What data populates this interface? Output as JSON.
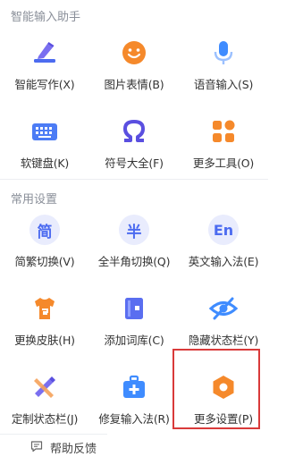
{
  "sections": {
    "assistant": {
      "title": "智能输入助手",
      "items": [
        {
          "label": "智能写作(X)",
          "icon": "pen-icon"
        },
        {
          "label": "图片表情(B)",
          "icon": "emoji-icon"
        },
        {
          "label": "语音输入(S)",
          "icon": "microphone-icon"
        },
        {
          "label": "软键盘(K)",
          "icon": "keyboard-icon"
        },
        {
          "label": "符号大全(F)",
          "icon": "omega-icon"
        },
        {
          "label": "更多工具(O)",
          "icon": "tools-grid-icon"
        }
      ]
    },
    "settings": {
      "title": "常用设置",
      "items": [
        {
          "label": "简繁切换(V)",
          "icon": "simplified-traditional-icon",
          "glyph": "简"
        },
        {
          "label": "全半角切换(Q)",
          "icon": "fullwidth-halfwidth-icon",
          "glyph": "半"
        },
        {
          "label": "英文输入法(E)",
          "icon": "english-input-icon",
          "glyph": "En"
        },
        {
          "label": "更换皮肤(H)",
          "icon": "skin-shirt-icon"
        },
        {
          "label": "添加词库(C)",
          "icon": "dictionary-book-icon"
        },
        {
          "label": "隐藏状态栏(Y)",
          "icon": "hide-eye-icon"
        },
        {
          "label": "定制状态栏(J)",
          "icon": "custom-pencil-ruler-icon"
        },
        {
          "label": "修复输入法(R)",
          "icon": "repair-toolbox-icon"
        },
        {
          "label": "更多设置(P)",
          "icon": "settings-hexagon-icon"
        }
      ]
    }
  },
  "footer": {
    "help_label": "帮助反馈"
  },
  "colors": {
    "accent": "#4c6bf0",
    "orange": "#f5892b",
    "highlight": "#d93a3a"
  }
}
